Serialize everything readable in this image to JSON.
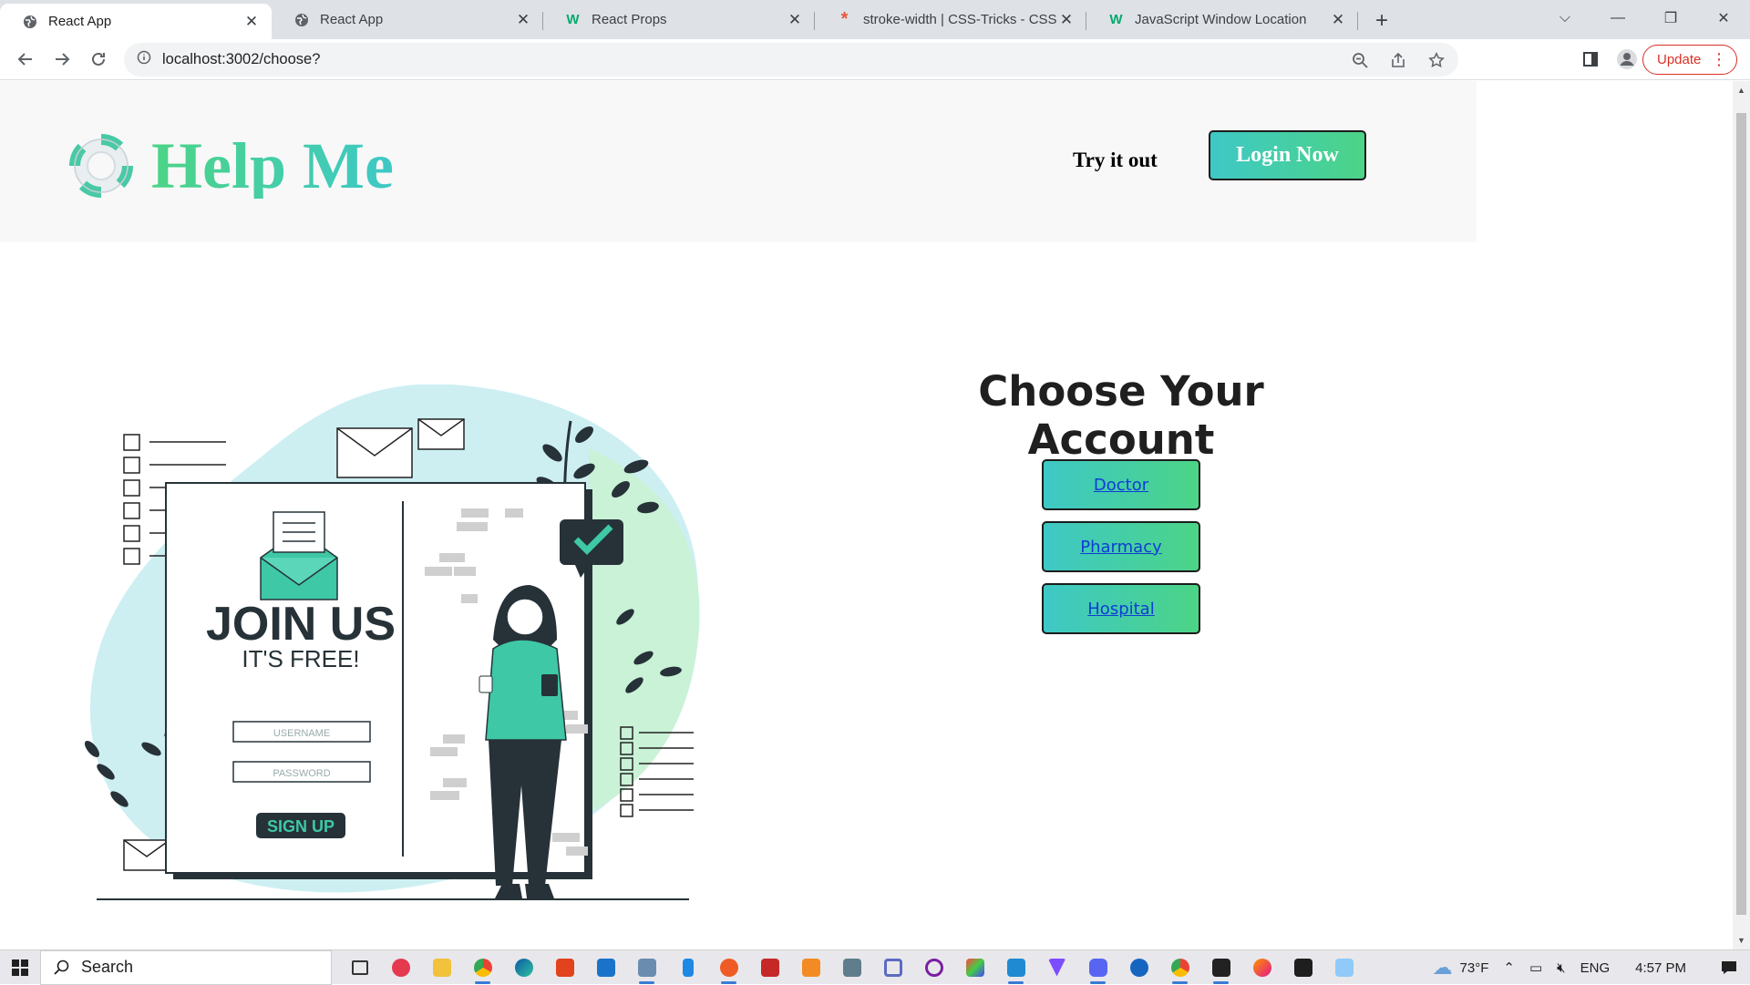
{
  "browser": {
    "tabs": [
      {
        "title": "React App",
        "favicon": "globe-icon",
        "active": true
      },
      {
        "title": "React App",
        "favicon": "globe-icon",
        "active": false
      },
      {
        "title": "React Props",
        "favicon": "w3schools-icon",
        "active": false
      },
      {
        "title": "stroke-width | CSS-Tricks - CSS-Tricks",
        "favicon": "csstricks-icon",
        "active": false
      },
      {
        "title": "JavaScript Window Location",
        "favicon": "w3schools-icon",
        "active": false
      }
    ],
    "url": "localhost:3002/choose?",
    "update_label": "Update"
  },
  "header": {
    "brand": "Help Me",
    "try_it_out": "Try it out",
    "login_label": "Login Now"
  },
  "illustration": {
    "join_title": "JOIN US",
    "join_sub": "IT'S FREE!",
    "username_placeholder": "USERNAME",
    "password_placeholder": "PASSWORD",
    "signup_label": "SIGN UP"
  },
  "main": {
    "title": "Choose Your Account",
    "accounts": [
      {
        "label": "Doctor"
      },
      {
        "label": "Pharmacy"
      },
      {
        "label": "Hospital"
      }
    ]
  },
  "taskbar": {
    "search_label": "Search",
    "temperature": "73°F",
    "language": "ENG",
    "time": "4:57 PM"
  },
  "colors": {
    "gradient_start": "#3ec8c6",
    "gradient_end": "#4cd486",
    "link": "#0e3dd6"
  }
}
